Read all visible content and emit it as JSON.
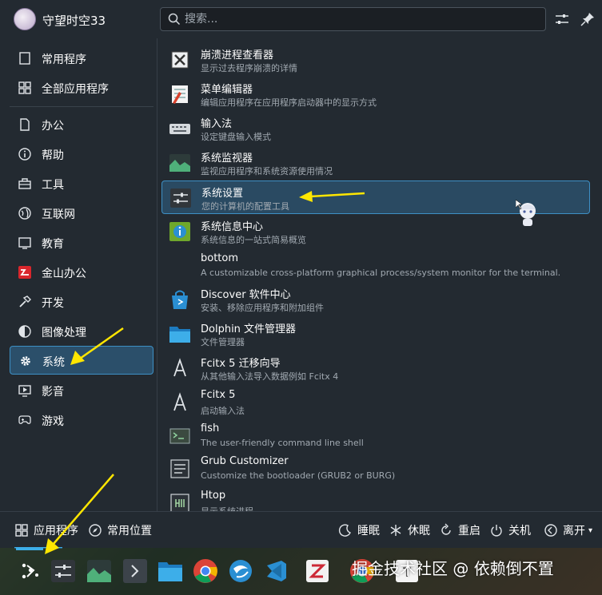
{
  "header": {
    "username": "守望时空33",
    "search_placeholder": "搜索..."
  },
  "sidebar": {
    "items": [
      {
        "label": "常用程序",
        "icon": "bookmark-icon"
      },
      {
        "label": "全部应用程序",
        "icon": "grid-icon"
      },
      {
        "label": "办公",
        "icon": "document-icon"
      },
      {
        "label": "帮助",
        "icon": "info-icon"
      },
      {
        "label": "工具",
        "icon": "toolbox-icon"
      },
      {
        "label": "互联网",
        "icon": "globe-icon"
      },
      {
        "label": "教育",
        "icon": "board-icon"
      },
      {
        "label": "金山办公",
        "icon": "wps-icon"
      },
      {
        "label": "开发",
        "icon": "hammer-icon"
      },
      {
        "label": "图像处理",
        "icon": "image-icon"
      },
      {
        "label": "系统",
        "icon": "gear-icon",
        "active": true
      },
      {
        "label": "影音",
        "icon": "video-icon"
      },
      {
        "label": "游戏",
        "icon": "gamepad-icon"
      }
    ]
  },
  "apps": [
    {
      "name": "崩溃进程查看器",
      "desc": "显示过去程序崩溃的详情"
    },
    {
      "name": "菜单编辑器",
      "desc": "编辑应用程序在应用程序启动器中的显示方式"
    },
    {
      "name": "输入法",
      "desc": "设定键盘输入模式"
    },
    {
      "name": "系统监视器",
      "desc": "监视应用程序和系统资源使用情况"
    },
    {
      "name": "系统设置",
      "desc": "您的计算机的配置工具",
      "active": true
    },
    {
      "name": "系统信息中心",
      "desc": "系统信息的一站式简易概览"
    },
    {
      "name": "bottom",
      "desc": "A customizable cross-platform graphical process/system monitor for the terminal."
    },
    {
      "name": "Discover 软件中心",
      "desc": "安装、移除应用程序和附加组件"
    },
    {
      "name": "Dolphin 文件管理器",
      "desc": "文件管理器"
    },
    {
      "name": "Fcitx 5 迁移向导",
      "desc": "从其他输入法导入数据例如 Fcitx 4"
    },
    {
      "name": "Fcitx 5",
      "desc": "启动输入法"
    },
    {
      "name": "fish",
      "desc": "The user-friendly command line shell"
    },
    {
      "name": "Grub Customizer",
      "desc": "Customize the bootloader (GRUB2 or BURG)"
    },
    {
      "name": "Htop",
      "desc": "显示系统进程"
    }
  ],
  "footer": {
    "apps_tab": "应用程序",
    "places_tab": "常用位置",
    "sleep": "睡眠",
    "hibernate": "休眠",
    "restart": "重启",
    "shutdown": "关机",
    "leave": "离开"
  },
  "taskbar": {
    "watermark": "掘金技术社区 @ 依赖倒不置"
  },
  "colors": {
    "accent": "#3daee9",
    "background": "#232a31",
    "active_row": "#2a4a62",
    "arrow": "#ffe600"
  }
}
